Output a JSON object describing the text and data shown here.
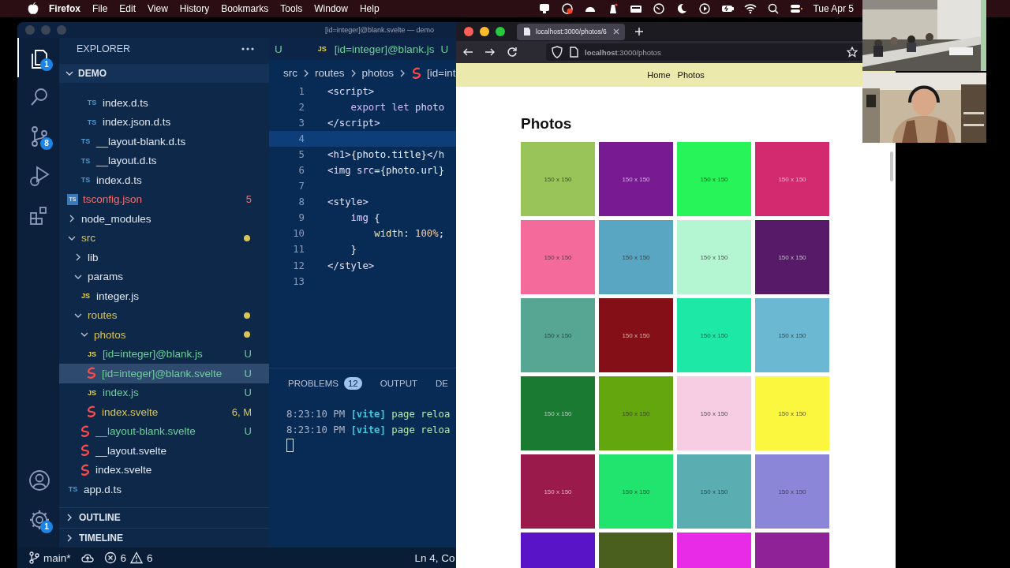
{
  "menubar": {
    "app": "Firefox",
    "items": [
      "File",
      "Edit",
      "View",
      "History",
      "Bookmarks",
      "Tools",
      "Window",
      "Help"
    ],
    "clock": "Tue Apr 5"
  },
  "editor_window": {
    "title": "[id=integer]@blank.svelte — demo",
    "activity": [
      {
        "kind": "explorer",
        "badge": "1",
        "selected": true
      },
      {
        "kind": "search",
        "selected": false
      },
      {
        "kind": "scm",
        "badge": "8",
        "selected": false
      },
      {
        "kind": "debug",
        "selected": false
      },
      {
        "kind": "extensions",
        "selected": false
      }
    ],
    "activity_bottom": [
      {
        "kind": "account",
        "selected": false
      },
      {
        "kind": "settings",
        "badge": "1",
        "selected": false
      }
    ],
    "sidebar": {
      "title": "EXPLORER",
      "root": {
        "label": "DEMO",
        "expanded": true
      },
      "tree": [
        {
          "children": [
            {
              "children": [
                {
                  "children": [
                    {
                      "label": "index.d.ts",
                      "kind": "ts",
                      "icon_label": "TS",
                      "selected": false
                    },
                    {
                      "label": "index.json.d.ts",
                      "kind": "ts",
                      "icon_label": "TS",
                      "selected": false
                    }
                  ]
                },
                {
                  "label": "__layout-blank.d.ts",
                  "kind": "ts",
                  "icon_label": "TS",
                  "selected": false
                },
                {
                  "label": "__layout.d.ts",
                  "kind": "ts",
                  "icon_label": "TS",
                  "selected": false
                },
                {
                  "label": "index.d.ts",
                  "kind": "ts",
                  "icon_label": "TS",
                  "selected": false
                }
              ]
            }
          ]
        },
        {
          "label": "tsconfig.json",
          "kind": "tsconfig",
          "icon_label": "TS",
          "color": "#f07070",
          "badge": "5",
          "selected": false
        },
        {
          "label": "node_modules",
          "kind": "folder",
          "expanded": false,
          "selected": false
        },
        {
          "label": "src",
          "kind": "folder",
          "expanded": true,
          "color": "#d8c458",
          "selected": false,
          "children": [
            {
              "label": "lib",
              "kind": "folder",
              "expanded": false,
              "selected": false
            },
            {
              "label": "params",
              "kind": "folder",
              "expanded": true,
              "selected": false,
              "children": [
                {
                  "label": "integer.js",
                  "kind": "js",
                  "icon_label": "JS",
                  "selected": false
                }
              ]
            },
            {
              "label": "routes",
              "kind": "folder",
              "expanded": true,
              "color": "#d8c458",
              "selected": false,
              "children": [
                {
                  "label": "photos",
                  "kind": "folder",
                  "expanded": true,
                  "color": "#d8c458",
                  "selected": false,
                  "children": [
                    {
                      "label": "[id=integer]@blank.js",
                      "kind": "js",
                      "icon_label": "JS",
                      "color": "#6cd09a",
                      "badge": "U",
                      "selected": false
                    },
                    {
                      "label": "[id=integer]@blank.svelte",
                      "kind": "svelte",
                      "color": "#6cd09a",
                      "badge": "U",
                      "selected": true
                    },
                    {
                      "label": "index.js",
                      "kind": "js",
                      "icon_label": "JS",
                      "color": "#6cd09a",
                      "badge": "U",
                      "selected": false
                    },
                    {
                      "label": "index.svelte",
                      "kind": "svelte",
                      "color": "#d8c458",
                      "badge": "6, M",
                      "selected": false
                    }
                  ]
                },
                {
                  "label": "__layout-blank.svelte",
                  "kind": "svelte",
                  "color": "#6cd09a",
                  "badge": "U",
                  "selected": false
                },
                {
                  "label": "__layout.svelte",
                  "kind": "svelte",
                  "selected": false
                },
                {
                  "label": "index.svelte",
                  "kind": "svelte",
                  "selected": false
                }
              ]
            }
          ]
        },
        {
          "label": "app.d.ts",
          "kind": "ts",
          "icon_label": "TS",
          "selected": false
        }
      ],
      "sections": [
        {
          "label": "OUTLINE",
          "expanded": false
        },
        {
          "label": "TIMELINE",
          "expanded": false
        }
      ]
    },
    "tabs": [
      {
        "badge": "U",
        "selected": false
      },
      {
        "kind": "js",
        "icon_label": "JS",
        "label": "[id=integer]@blank.js",
        "badge": "U",
        "selected": false
      }
    ],
    "breadcrumb": [
      {
        "label": "src"
      },
      {
        "label": "routes"
      },
      {
        "label": "photos"
      },
      {
        "label": "[id=int",
        "kind": "svelte"
      }
    ],
    "code": [
      {
        "n": "1",
        "tokens": [
          {
            "kind": "tag",
            "t": "<script>"
          }
        ]
      },
      {
        "n": "2",
        "tokens": [
          {
            "kind": "keyword",
            "t": "    export let "
          },
          {
            "kind": "var",
            "t": "photo"
          }
        ]
      },
      {
        "n": "3",
        "tokens": [
          {
            "kind": "tag",
            "t": "</script>"
          }
        ]
      },
      {
        "n": "4",
        "current": true
      },
      {
        "n": "5",
        "tokens": [
          {
            "kind": "tag",
            "t": "<h1>"
          },
          {
            "kind": "plain",
            "t": "{photo.title}"
          },
          {
            "kind": "tag",
            "t": "</h"
          }
        ]
      },
      {
        "n": "6",
        "tokens": [
          {
            "kind": "tag",
            "t": "<img "
          },
          {
            "kind": "var",
            "t": "src"
          },
          {
            "kind": "plain",
            "t": "={photo.url}"
          }
        ]
      },
      {
        "n": "7"
      },
      {
        "n": "8",
        "tokens": [
          {
            "kind": "tag",
            "t": "<style>"
          }
        ]
      },
      {
        "n": "9",
        "tokens": [
          {
            "kind": "var",
            "t": "    img "
          },
          {
            "kind": "plain",
            "t": "{"
          }
        ]
      },
      {
        "n": "10",
        "tokens": [
          {
            "kind": "prop",
            "t": "        width"
          },
          {
            "kind": "plain",
            "t": ": "
          },
          {
            "kind": "num",
            "t": "100%"
          },
          {
            "kind": "plain",
            "t": ";"
          }
        ]
      },
      {
        "n": "11",
        "tokens": [
          {
            "kind": "plain",
            "t": "    }"
          }
        ]
      },
      {
        "n": "12",
        "tokens": [
          {
            "kind": "tag",
            "t": "</style>"
          }
        ]
      },
      {
        "n": "13"
      }
    ],
    "panel": {
      "tabs": [
        {
          "label": "PROBLEMS",
          "badge": "12",
          "selected": false
        },
        {
          "label": "OUTPUT",
          "selected": false
        },
        {
          "label": "DE",
          "selected": false
        }
      ],
      "terminal": [
        [
          {
            "kind": "time",
            "t": "8:23:10 PM "
          },
          {
            "kind": "tool",
            "t": "[vite]"
          },
          {
            "kind": "msg",
            "t": " page reloa"
          }
        ],
        [
          {
            "kind": "time",
            "t": "8:23:10 PM "
          },
          {
            "kind": "tool",
            "t": "[vite]"
          },
          {
            "kind": "msg",
            "t": " page reloa"
          }
        ]
      ]
    },
    "status_bar": {
      "branch": "main*",
      "errors": "6",
      "warnings": "6",
      "position": "Ln 4, Co"
    }
  },
  "browser": {
    "tab": {
      "title": "localhost:3000/photos/6",
      "selected": true
    },
    "url": "**localhost**:3000/photos",
    "page": {
      "nav": [
        "Home",
        "Photos"
      ],
      "heading": "Photos",
      "tiles": [
        {
          "color": "#98c45a",
          "label": "150 x 150"
        },
        {
          "color": "#781a92",
          "label": "150 x 150"
        },
        {
          "color": "#27f458",
          "label": "150 x 150"
        },
        {
          "color": "#d32a6f",
          "label": "150 x 150"
        },
        {
          "color": "#f46b9b",
          "label": "150 x 150"
        },
        {
          "color": "#58a6c2",
          "label": "150 x 150"
        },
        {
          "color": "#b4f5d2",
          "label": "150 x 150"
        },
        {
          "color": "#561a68",
          "label": "150 x 150"
        },
        {
          "color": "#56a693",
          "label": "150 x 150"
        },
        {
          "color": "#850f16",
          "label": "150 x 150"
        },
        {
          "color": "#1de8a5",
          "label": "150 x 150"
        },
        {
          "color": "#6ab8d2",
          "label": "150 x 150"
        },
        {
          "color": "#1a7a32",
          "label": "150 x 150"
        },
        {
          "color": "#64a60e",
          "label": "150 x 150"
        },
        {
          "color": "#f6cde2",
          "label": "150 x 150"
        },
        {
          "color": "#fbf73e",
          "label": "150 x 150"
        },
        {
          "color": "#9b1a4c",
          "label": "150 x 150"
        },
        {
          "color": "#21e46e",
          "label": "150 x 150"
        },
        {
          "color": "#5aaeb2",
          "label": "150 x 150"
        },
        {
          "color": "#8c86d9",
          "label": "150 x 150"
        },
        {
          "color": "#5a14c8"
        },
        {
          "color": "#4a5e1e"
        },
        {
          "color": "#e82be6"
        },
        {
          "color": "#8e2296"
        }
      ]
    }
  }
}
